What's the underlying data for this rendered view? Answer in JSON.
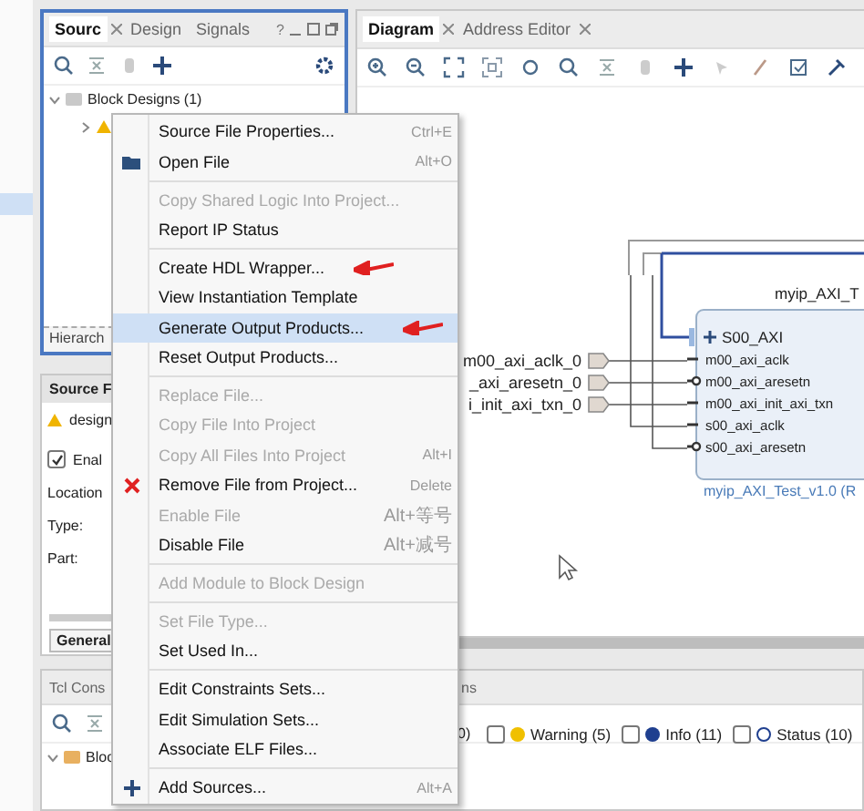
{
  "sources_panel": {
    "tabs": [
      {
        "label": "Sourc",
        "selected": true
      },
      {
        "label": "Design",
        "selected": false
      },
      {
        "label": "Signals",
        "selected": false
      }
    ],
    "help": "?",
    "tree": [
      {
        "label": "Block Designs (1)",
        "expanded": true,
        "children": [
          {
            "expanded": false,
            "warning": true
          }
        ]
      }
    ],
    "bottom_tab": "Hierarch"
  },
  "properties_panel": {
    "title": "Source F",
    "file": "design",
    "enable": {
      "label": "Enal",
      "checked": true
    },
    "fields": [
      "Location",
      "Type:",
      "Part:"
    ],
    "tab": "General"
  },
  "tcl_panel": {
    "title": "Tcl Cons",
    "tree": [
      {
        "label": "Bloc",
        "expanded": true
      }
    ]
  },
  "diagram_panel": {
    "tabs": [
      {
        "label": "Diagram",
        "selected": true
      },
      {
        "label": "Address Editor",
        "selected": false
      }
    ],
    "external_ports": [
      {
        "label": "m00_axi_aclk_0"
      },
      {
        "label": "_axi_aresetn_0"
      },
      {
        "label": "i_init_axi_txn_0"
      }
    ],
    "block": {
      "title": "myip_AXI_T",
      "subtitle": "myip_AXI_Test_v1.0 (R",
      "pins": [
        {
          "name": "S00_AXI",
          "kind": "bus"
        },
        {
          "name": "m00_axi_aclk",
          "kind": "plain"
        },
        {
          "name": "m00_axi_aresetn",
          "kind": "inverted"
        },
        {
          "name": "m00_axi_init_axi_txn",
          "kind": "plain"
        },
        {
          "name": "s00_axi_aclk",
          "kind": "plain"
        },
        {
          "name": "s00_axi_aresetn",
          "kind": "inverted"
        }
      ]
    }
  },
  "messages_panel": {
    "tab": "ns",
    "fragment": "0)",
    "filters": [
      {
        "label": "Warning (5)",
        "kind": "warning",
        "checked": false
      },
      {
        "label": "Info (11)",
        "kind": "info",
        "checked": false
      },
      {
        "label": "Status (10)",
        "kind": "status",
        "checked": false
      }
    ]
  },
  "context_menu": {
    "groups": [
      [
        {
          "label": "Source File Properties...",
          "shortcut": "Ctrl+E",
          "disabled": false,
          "selected": false,
          "marked": false
        },
        {
          "label": "Open File",
          "shortcut": "Alt+O",
          "kind": "folder",
          "disabled": false,
          "selected": false,
          "marked": false
        }
      ],
      [
        {
          "label": "Copy Shared Logic Into Project...",
          "disabled": true,
          "selected": false,
          "marked": false
        },
        {
          "label": "Report IP Status",
          "disabled": false,
          "selected": false,
          "marked": false
        }
      ],
      [
        {
          "label": "Create HDL Wrapper...",
          "disabled": false,
          "selected": false,
          "marked": true
        },
        {
          "label": "View Instantiation Template",
          "disabled": false,
          "selected": false,
          "marked": false
        },
        {
          "label": "Generate Output Products...",
          "disabled": false,
          "selected": true,
          "marked": true
        },
        {
          "label": "Reset Output Products...",
          "disabled": false,
          "selected": false,
          "marked": false
        }
      ],
      [
        {
          "label": "Replace File...",
          "disabled": true,
          "selected": false,
          "marked": false
        },
        {
          "label": "Copy File Into Project",
          "disabled": true,
          "selected": false,
          "marked": false
        },
        {
          "label": "Copy All Files Into Project",
          "shortcut": "Alt+I",
          "disabled": true,
          "selected": false,
          "marked": false
        },
        {
          "label": "Remove File from Project...",
          "shortcut": "Delete",
          "kind": "remove",
          "disabled": false,
          "selected": false,
          "marked": false
        },
        {
          "label": "Enable File",
          "shortcut": "Alt+等号",
          "disabled": true,
          "selected": false,
          "marked": false
        },
        {
          "label": "Disable File",
          "shortcut": "Alt+减号",
          "disabled": false,
          "selected": false,
          "marked": false
        }
      ],
      [
        {
          "label": "Add Module to Block Design",
          "disabled": true,
          "selected": false,
          "marked": false
        }
      ],
      [
        {
          "label": "Set File Type...",
          "disabled": true,
          "selected": false,
          "marked": false
        },
        {
          "label": "Set Used In...",
          "disabled": false,
          "selected": false,
          "marked": false
        }
      ],
      [
        {
          "label": "Edit Constraints Sets...",
          "disabled": false,
          "selected": false,
          "marked": false
        },
        {
          "label": "Edit Simulation Sets...",
          "disabled": false,
          "selected": false,
          "marked": false
        },
        {
          "label": "Associate ELF Files...",
          "disabled": false,
          "selected": false,
          "marked": false
        }
      ],
      [
        {
          "label": "Add Sources...",
          "shortcut": "Alt+A",
          "kind": "add",
          "disabled": false,
          "selected": false,
          "marked": false
        }
      ]
    ]
  }
}
